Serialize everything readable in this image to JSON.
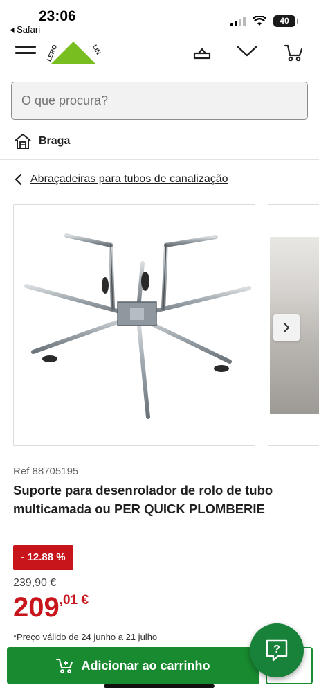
{
  "status_bar": {
    "time": "23:06",
    "back_label": "◂ Safari",
    "battery": "40"
  },
  "header": {
    "menu_icon": "hamburger-menu-icon",
    "logo_icon": "leroy-merlin-logo",
    "icons": [
      "account-icon",
      "chevron-down-icon",
      "cart-icon"
    ]
  },
  "search": {
    "placeholder": "O que procura?"
  },
  "store": {
    "icon": "store-icon",
    "label": "Braga"
  },
  "breadcrumb": {
    "icon": "chevron-left-icon",
    "label": "Abraçadeiras para tubos de canalização"
  },
  "gallery": {
    "next_icon": "chevron-right-icon"
  },
  "product": {
    "ref": "Ref 88705195",
    "title": "Suporte para desenrolador de rolo de tubo multicamada ou PER QUICK PLOMBERIE",
    "discount": "- 12.88 %",
    "old_price": "239,90 €",
    "price_integer": "209",
    "price_decimal": ",01 €",
    "note": "*Preço válido de 24 junho a 21 julho"
  },
  "actions": {
    "add_to_cart": "Adicionar ao carrinho",
    "help_icon": "help-chat-icon"
  },
  "colors": {
    "brand_green": "#188a2f",
    "promo_red": "#c8141b"
  }
}
